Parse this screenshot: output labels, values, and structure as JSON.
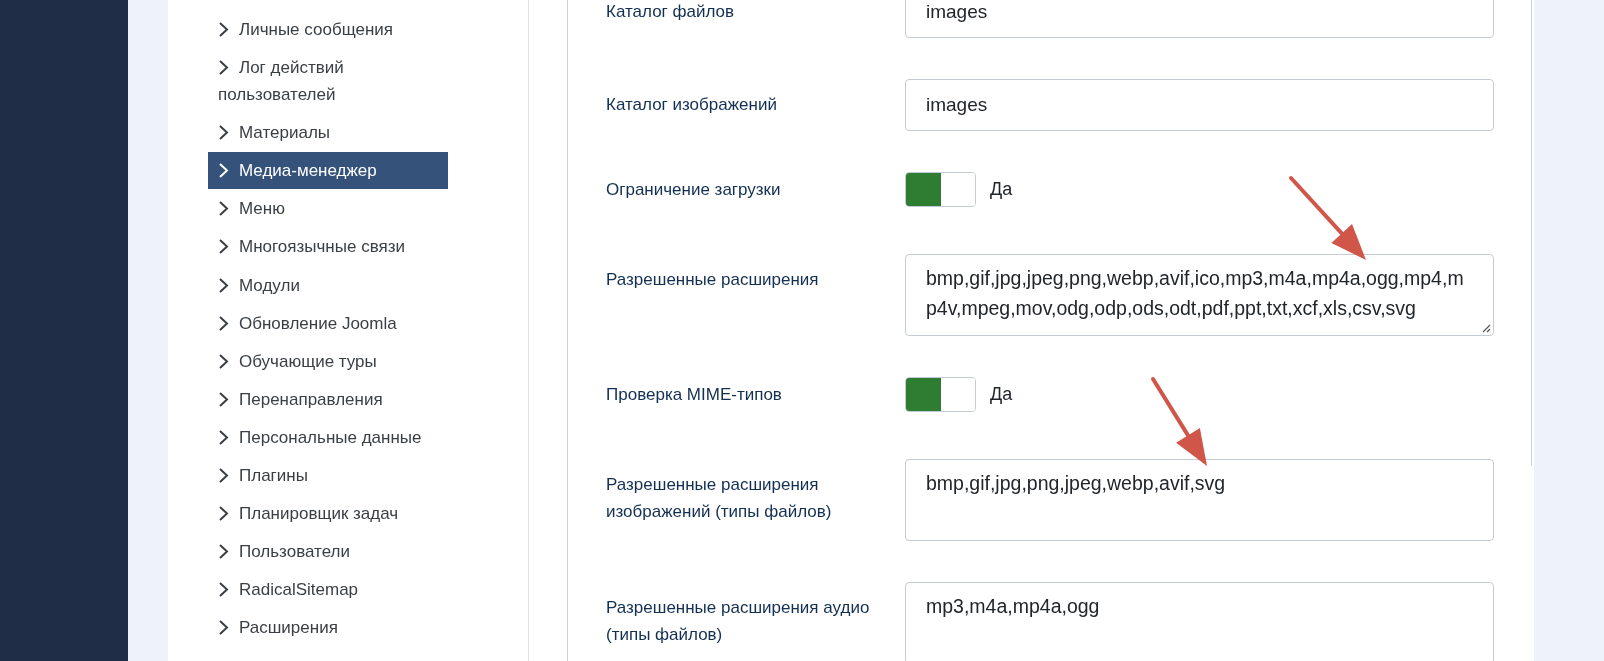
{
  "sidebar": {
    "items": [
      {
        "label": "Личные сообщения",
        "selected": false
      },
      {
        "label": "Лог действий пользователей",
        "selected": false
      },
      {
        "label": "Материалы",
        "selected": false
      },
      {
        "label": "Медиа-менеджер",
        "selected": true
      },
      {
        "label": "Меню",
        "selected": false
      },
      {
        "label": "Многоязычные связи",
        "selected": false
      },
      {
        "label": "Модули",
        "selected": false
      },
      {
        "label": "Обновление Joomla",
        "selected": false
      },
      {
        "label": "Обучающие туры",
        "selected": false
      },
      {
        "label": "Перенаправления",
        "selected": false
      },
      {
        "label": "Персональные данные",
        "selected": false
      },
      {
        "label": "Плагины",
        "selected": false
      },
      {
        "label": "Планировщик задач",
        "selected": false
      },
      {
        "label": "Пользователи",
        "selected": false
      },
      {
        "label": "RadicalSitemap",
        "selected": false
      },
      {
        "label": "Расширения",
        "selected": false
      }
    ]
  },
  "form": {
    "fields": [
      {
        "kind": "text",
        "label": "Каталог файлов",
        "value": "images"
      },
      {
        "kind": "text",
        "label": "Каталог изображений",
        "value": "images"
      },
      {
        "kind": "toggle",
        "label": "Ограничение загрузки",
        "on": true,
        "text": "Да"
      },
      {
        "kind": "textarea",
        "label": "Разрешенные расширения",
        "value": "bmp,gif,jpg,jpeg,png,webp,avif,ico,mp3,m4a,mp4a,ogg,mp4,mp4v,mpeg,mov,odg,odp,ods,odt,pdf,ppt,txt,xcf,xls,csv,svg",
        "resize_handle": true
      },
      {
        "kind": "toggle",
        "label": "Проверка MIME-типов",
        "on": true,
        "text": "Да"
      },
      {
        "kind": "textarea",
        "label": "Разрешенные расширения изображений (типы файлов)",
        "value": "bmp,gif,jpg,png,jpeg,webp,avif,svg",
        "resize_handle": false
      },
      {
        "kind": "textarea",
        "label": "Разрешенные расширения аудио (типы файлов)",
        "value": "mp3,m4a,mp4a,ogg",
        "resize_handle": false
      }
    ]
  }
}
